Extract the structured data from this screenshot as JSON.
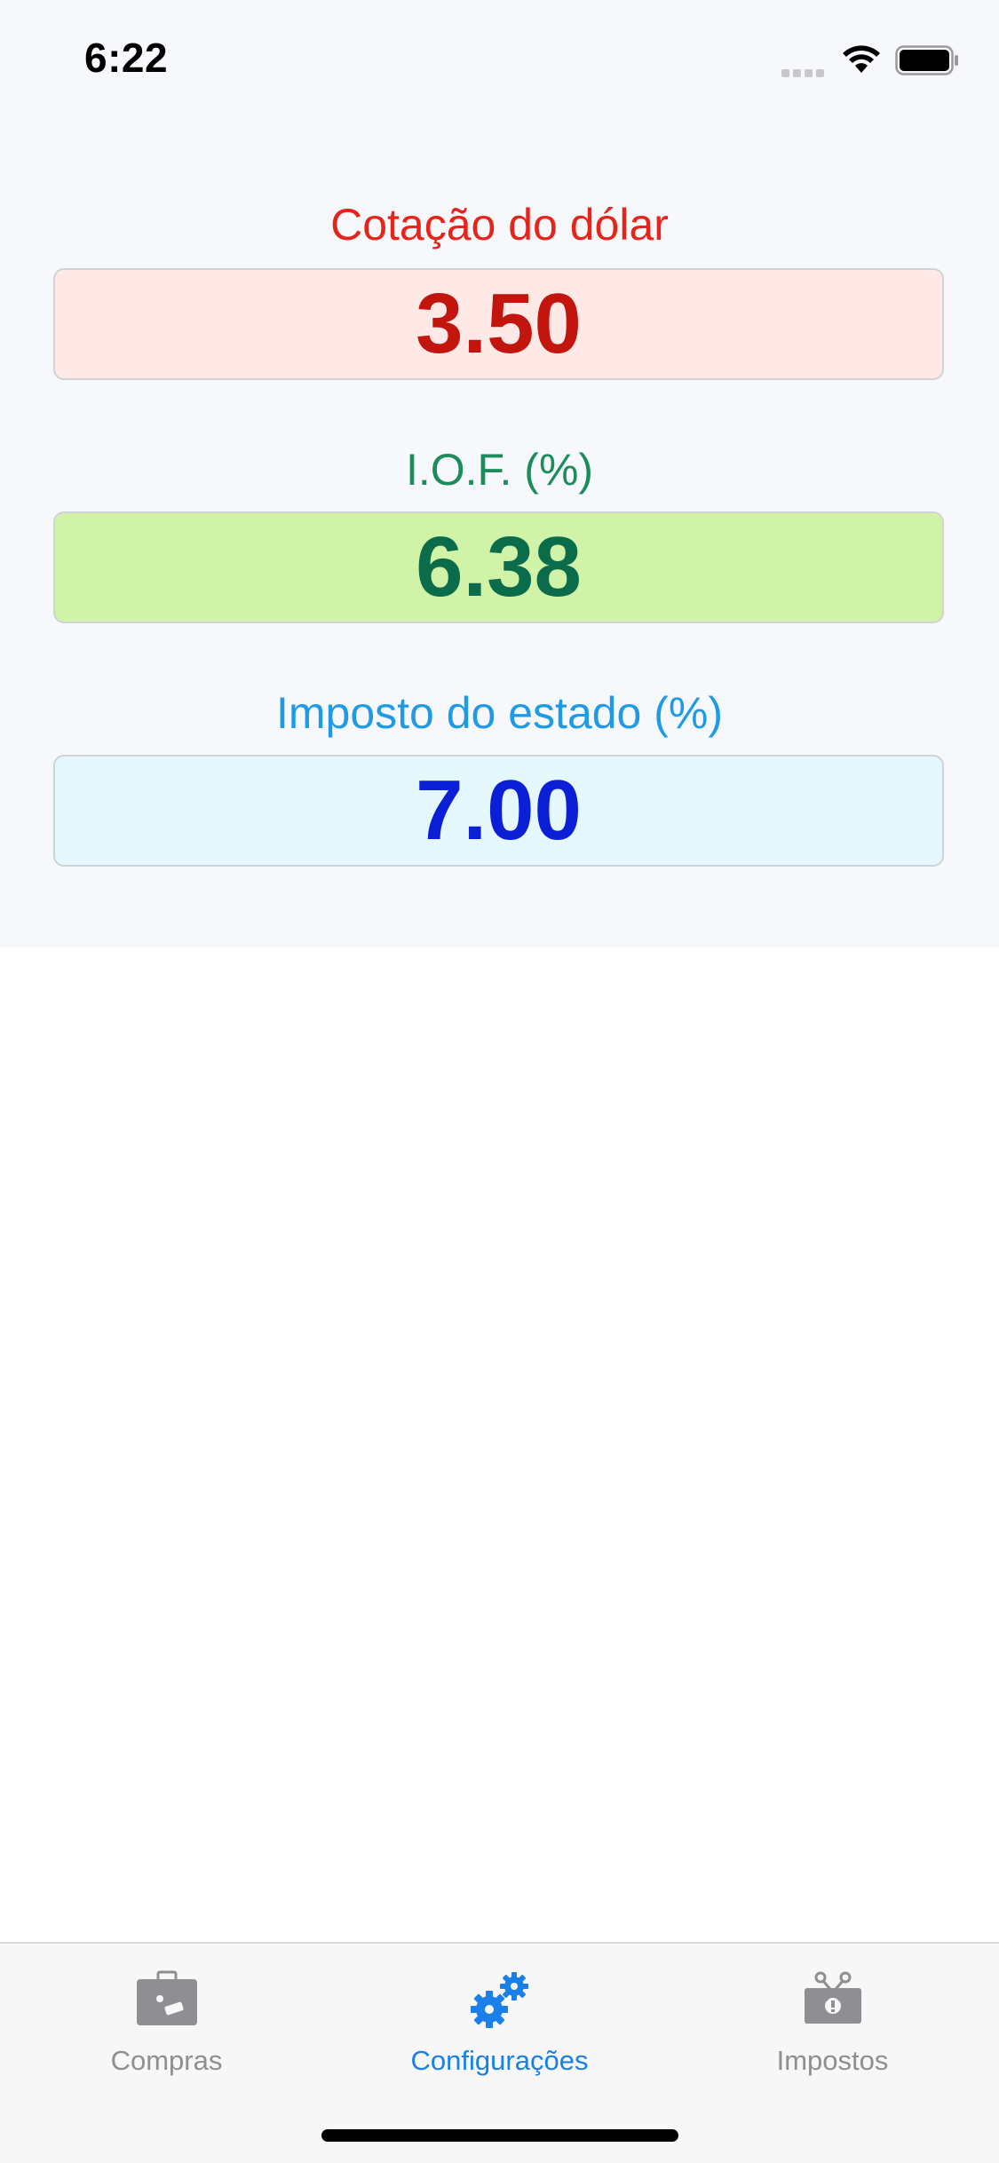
{
  "status_bar": {
    "time": "6:22"
  },
  "settings": {
    "dollar_rate": {
      "label": "Cotação do dólar",
      "value": "3.50"
    },
    "iof": {
      "label": "I.O.F. (%)",
      "value": "6.38"
    },
    "state_tax": {
      "label": "Imposto do estado (%)",
      "value": "7.00"
    }
  },
  "tab_bar": {
    "tabs": [
      {
        "label": "Compras",
        "icon": "suitcase-icon",
        "selected": false
      },
      {
        "label": "Configurações",
        "icon": "gears-icon",
        "selected": true
      },
      {
        "label": "Impostos",
        "icon": "taxed-money-icon",
        "selected": false
      }
    ],
    "active_color": "#1a7fe6",
    "inactive_color": "#8e8e93"
  },
  "colors": {
    "dollar_label": "#e5251b",
    "dollar_value": "#c2150d",
    "dollar_bg": "#ffe9e7",
    "iof_label": "#1c8d5a",
    "iof_value": "#0b6c4b",
    "iof_bg": "#d1f3a8",
    "state_label": "#1f9be6",
    "state_value": "#0a1fd6",
    "state_bg": "#e4f8fe"
  }
}
